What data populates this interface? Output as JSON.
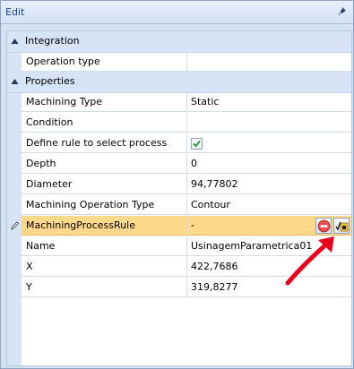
{
  "window": {
    "title": "Edit",
    "pin_icon": "pin-icon"
  },
  "categories": [
    {
      "label": "Integration",
      "expanded": true
    },
    {
      "label": "Properties",
      "expanded": true
    }
  ],
  "properties": {
    "operation_type": {
      "name": "Operation type",
      "value": ""
    },
    "machining_type": {
      "name": "Machining Type",
      "value": "Static"
    },
    "condition": {
      "name": "Condition",
      "value": ""
    },
    "define_rule": {
      "name": "Define rule to select process",
      "checked": true
    },
    "depth": {
      "name": "Depth",
      "value": "0"
    },
    "diameter": {
      "name": "Diameter",
      "value": "94,77802"
    },
    "machining_operation_type": {
      "name": "Machining Operation Type",
      "value": "Contour"
    },
    "machining_process_rule": {
      "name": "MachiningProcessRule",
      "value": "-"
    },
    "name": {
      "name": "Name",
      "value": "UsinagemParametrica01"
    },
    "x": {
      "name": "X",
      "value": "422,7686"
    },
    "y": {
      "name": "Y",
      "value": "319,8277"
    }
  },
  "colors": {
    "selection": "#fdd98b",
    "category_bg": "#d6e4f5",
    "title_text": "#15428b",
    "arrow": "#e8001c"
  }
}
